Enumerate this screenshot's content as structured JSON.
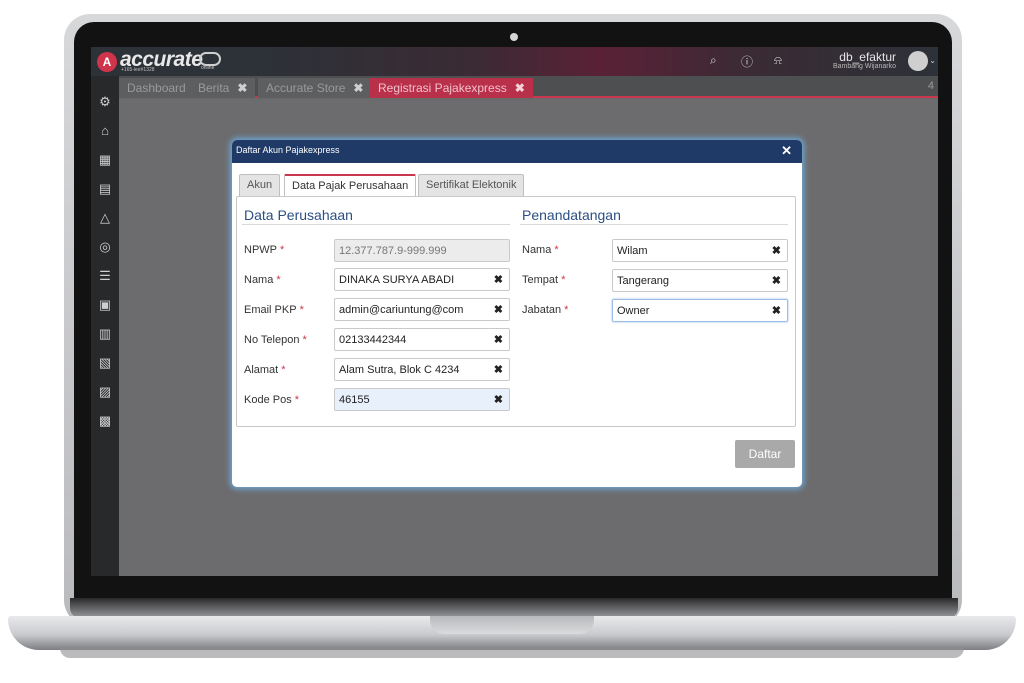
{
  "app": {
    "logo_text": "accurate",
    "logo_sub": "+165-lee#1328",
    "online_label": "online",
    "db_name": "db_efaktur",
    "user_name": "Bambang Wijanarko",
    "icons": [
      "search-icon",
      "help-icon",
      "bell-icon"
    ]
  },
  "tabs": [
    {
      "label": "Dashboard",
      "closable": false
    },
    {
      "label": "Berita",
      "closable": true
    },
    {
      "label": "Accurate Store",
      "closable": true
    },
    {
      "label": "Registrasi Pajakexpress",
      "closable": true,
      "active": true
    }
  ],
  "tab_count": "4",
  "sidebar": {
    "icons": [
      "settings-icon",
      "company-icon",
      "building-icon",
      "ledger-icon",
      "bank-icon",
      "money-bag-icon",
      "cart-icon",
      "delivery-icon",
      "inventory-icon",
      "factory-icon",
      "report-icon",
      "page-icon"
    ]
  },
  "dialog": {
    "title": "Daftar Akun Pajakexpress",
    "tabs": [
      "Akun",
      "Data Pajak Perusahaan",
      "Sertifikat Elektonik"
    ],
    "active_tab": "Data Pajak Perusahaan",
    "left": {
      "title": "Data Perusahaan",
      "fields": [
        {
          "label": "NPWP",
          "value": "12.377.787.9-999.999",
          "readonly": true
        },
        {
          "label": "Nama",
          "value": "DINAKA SURYA ABADI"
        },
        {
          "label": "Email PKP",
          "value": "admin@cariuntung@com"
        },
        {
          "label": "No Telepon",
          "value": "02133442344"
        },
        {
          "label": "Alamat",
          "value": "Alam Sutra, Blok C 4234"
        },
        {
          "label": "Kode Pos",
          "value": "46155",
          "highlighted": true
        }
      ]
    },
    "right": {
      "title": "Penandatangan",
      "fields": [
        {
          "label": "Nama",
          "value": "Wilam"
        },
        {
          "label": "Tempat",
          "value": "Tangerang"
        },
        {
          "label": "Jabatan",
          "value": "Owner",
          "focused": true
        }
      ]
    },
    "required_mark": "*",
    "clear_glyph": "✖",
    "submit_label": "Daftar"
  },
  "colors": {
    "accent": "#c9364d",
    "dialog_header": "#1f3a66",
    "section_title": "#2c4f84"
  }
}
